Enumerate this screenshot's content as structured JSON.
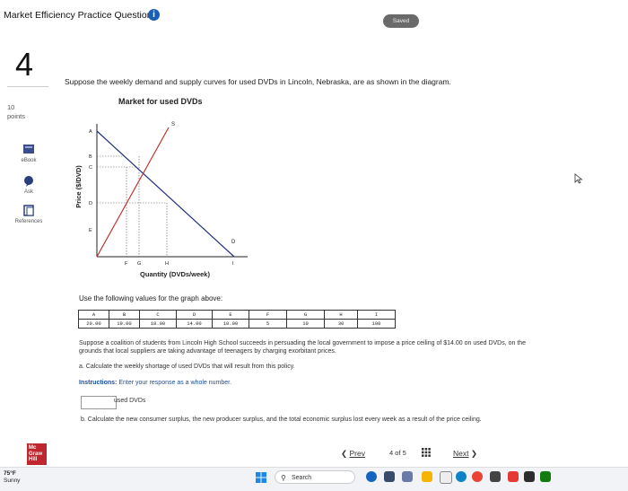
{
  "header": {
    "title": "Market Efficiency Practice Questions",
    "info_icon": "info-icon",
    "saved_label": "Saved"
  },
  "question": {
    "number": "4",
    "points_value": "10",
    "points_label": "points",
    "prompt": "Suppose the weekly demand and supply curves for used DVDs in Lincoln, Nebraska, are as shown in the diagram."
  },
  "sidebar": {
    "items": [
      {
        "label": "eBook",
        "icon": "ebook-icon"
      },
      {
        "label": "Ask",
        "icon": "ask-icon"
      },
      {
        "label": "References",
        "icon": "references-icon"
      }
    ]
  },
  "chart_data": {
    "type": "line",
    "title": "Market for used DVDs",
    "xlabel": "Quantity (DVDs/week)",
    "ylabel": "Price ($/DVD)",
    "y_tick_labels": [
      "A",
      "B",
      "C",
      "D",
      "E"
    ],
    "x_tick_labels": [
      "F",
      "G",
      "H",
      "I"
    ],
    "series": [
      {
        "name": "S",
        "x": [
          0,
          30
        ],
        "y": [
          0,
          28
        ]
      },
      {
        "name": "D",
        "x": [
          0,
          100
        ],
        "y": [
          20,
          0
        ]
      }
    ],
    "curve_labels": [
      "S",
      "D"
    ]
  },
  "values_intro": "Use the following values for the graph above:",
  "values_table": {
    "headers": [
      "A",
      "B",
      "C",
      "D",
      "E",
      "F",
      "G",
      "H",
      "I"
    ],
    "values": [
      "20.00",
      "19.00",
      "18.00",
      "14.00",
      "10.00",
      "5",
      "10",
      "30",
      "100"
    ]
  },
  "scenario": "Suppose a coalition of students from Lincoln High School succeeds in persuading the local government to impose a price ceiling of $14.00 on used DVDs, on the grounds that local suppliers are taking advantage of teenagers by charging exorbitant prices.",
  "part_a": "a. Calculate the weekly shortage of used DVDs that will result from this policy.",
  "instructions_label": "Instructions:",
  "instructions_text": "Enter your response as a whole number.",
  "answer": {
    "value": "",
    "unit": "used DVDs"
  },
  "part_b": "b. Calculate the new consumer surplus, the new producer surplus, and the total economic surplus lost every week as a result of the price ceiling.",
  "navigation": {
    "prev_label": "Prev",
    "page_indicator": "4 of 5",
    "next_label": "Next"
  },
  "logo_text": "Mc Graw Hill",
  "taskbar": {
    "temperature": "75°F",
    "weather": "Sunny",
    "search_label": "Search"
  }
}
